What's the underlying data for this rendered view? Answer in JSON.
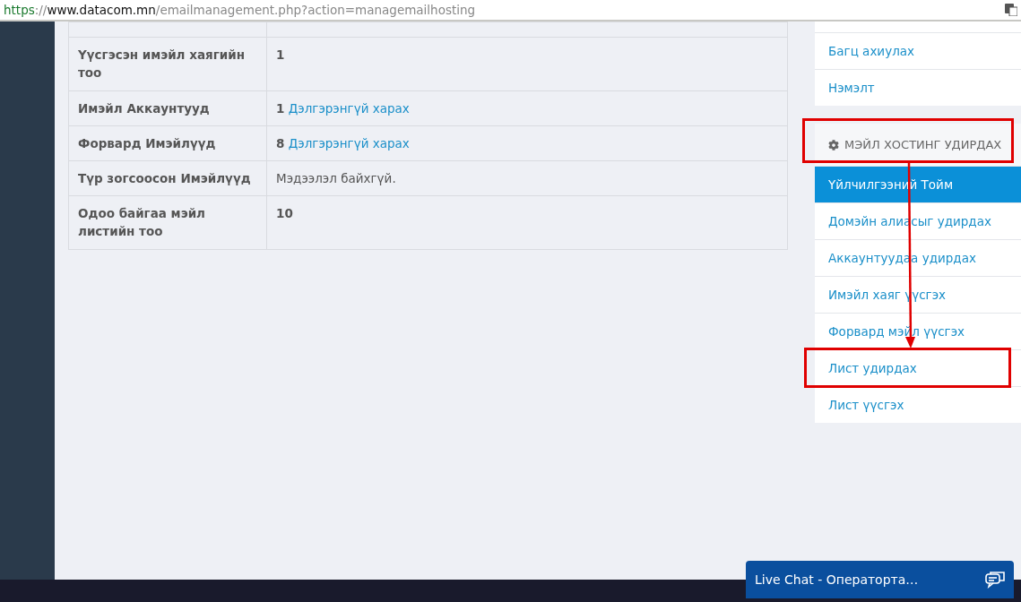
{
  "address_bar": {
    "scheme": "https",
    "separator": "://",
    "host": "www.datacom.mn",
    "path": "/emailmanagement.php?action=managemailhosting"
  },
  "table": {
    "rows": [
      {
        "label": "Үүсгэсэн имэйл хаягийн тоо",
        "count": "1"
      },
      {
        "label": "Имэйл Аккаунтууд",
        "count": "1",
        "link": "Дэлгэрэнгүй харах"
      },
      {
        "label": "Форвард Имэйлүүд",
        "count": "8",
        "link": "Дэлгэрэнгүй харах"
      },
      {
        "label": "Түр зогсоосон Имэйлүүд",
        "text": "Мэдээлэл байхгүй."
      },
      {
        "label": "Одоо байгаа мэйл листийн тоо",
        "count": "10"
      }
    ]
  },
  "top_menu": {
    "items": [
      {
        "label": "Багц ахиулах"
      },
      {
        "label": "Нэмэлт"
      }
    ]
  },
  "mail_menu": {
    "heading": "МЭЙЛ ХОСТИНГ УДИРДАХ",
    "items": [
      {
        "label": "Үйлчилгээний Тойм",
        "selected": true
      },
      {
        "label": "Домэйн алиасыг удирдах",
        "selected": false
      },
      {
        "label": "Аккаунтуудаа удирдах",
        "selected": false
      },
      {
        "label": "Имэйл хаяг үүсгэх",
        "selected": false
      },
      {
        "label": "Форвард мэйл үүсгэх",
        "selected": false
      },
      {
        "label": "Лист удирдах",
        "selected": false
      },
      {
        "label": "Лист үүсгэх",
        "selected": false
      }
    ]
  },
  "live_chat": {
    "label": "Live Chat - Операторта…"
  }
}
